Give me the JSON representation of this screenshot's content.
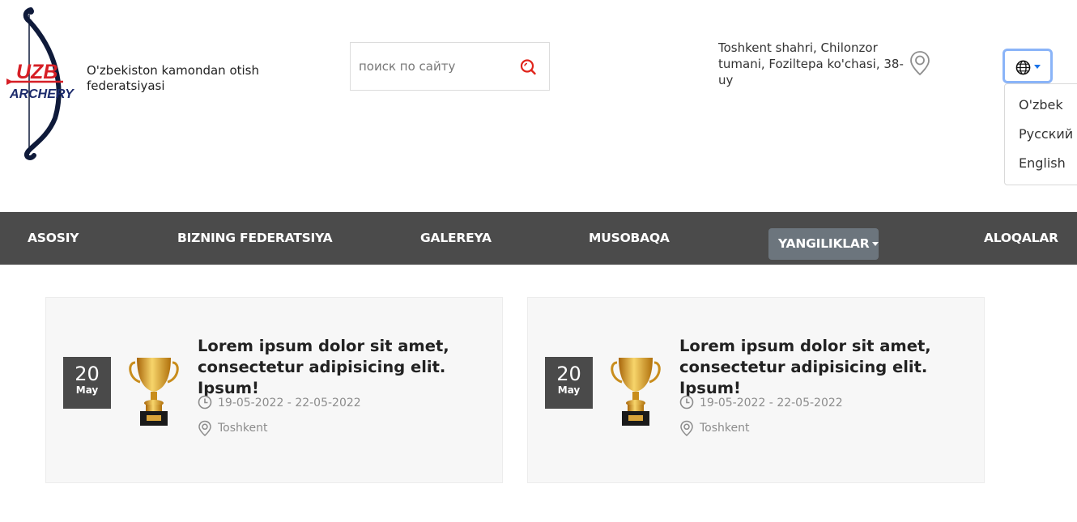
{
  "header": {
    "logo": {
      "lettering_top": "UZB",
      "lettering_bottom": "ARCHERY",
      "icon": "bow-and-arrow-logo",
      "brand_colors": {
        "red": "#d61f26",
        "navy": "#1b2a6b",
        "bow": "#0f1a3a"
      }
    },
    "federation_name": "O'zbekiston kamondan otish federatsiyasi",
    "search": {
      "placeholder": "поиск по сайту",
      "value": "",
      "icon": "search-icon",
      "icon_color": "#e0241b"
    },
    "address": "Toshkent shahri, Chilonzor tumani, Foziltepa ko'chasi, 38-uy",
    "address_icon": "map-pin-icon",
    "language": {
      "button_icon": "globe-icon",
      "options": [
        "O'zbek",
        "Русский",
        "English"
      ]
    }
  },
  "nav": {
    "background": "#4b4b4b",
    "items": [
      "ASOSIY",
      "BIZNING FEDERATSIYA",
      "GALEREYA",
      "MUSOBAQA",
      "YANGILIKLAR",
      "ALOQALAR"
    ],
    "active": "YANGILIKLAR",
    "active_color": "#6c757d"
  },
  "events": [
    {
      "day": "20",
      "month": "May",
      "title": "Lorem ipsum dolor sit amet, consectetur adipisicing elit. Ipsum!",
      "dates": "19-05-2022 - 22-05-2022",
      "location": "Toshkent",
      "image": "trophy-icon"
    },
    {
      "day": "20",
      "month": "May",
      "title": "Lorem ipsum dolor sit amet, consectetur adipisicing elit. Ipsum!",
      "dates": "19-05-2022 - 22-05-2022",
      "location": "Toshkent",
      "image": "trophy-icon"
    }
  ]
}
